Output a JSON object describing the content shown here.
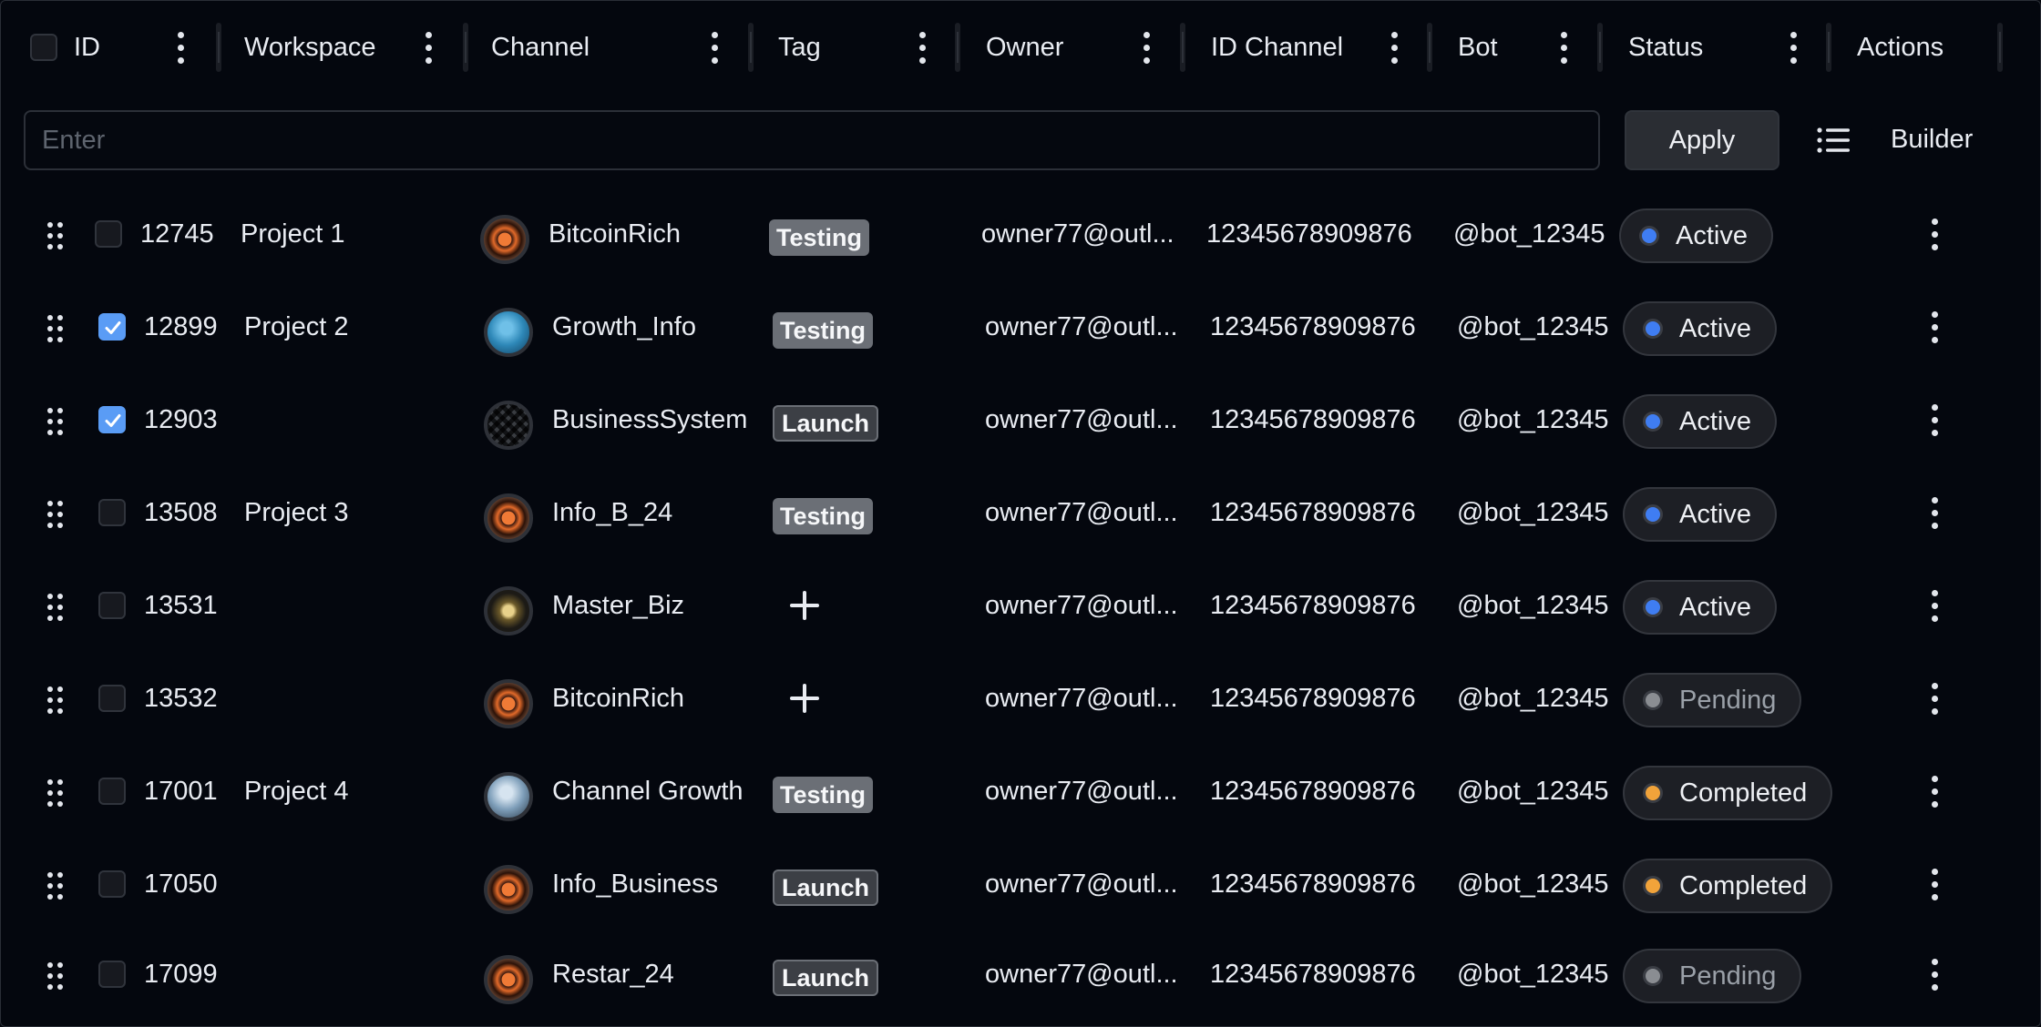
{
  "columns": {
    "id": "ID",
    "workspace": "Workspace",
    "channel": "Channel",
    "tag": "Tag",
    "owner": "Owner",
    "id_channel": "ID Channel",
    "bot": "Bot",
    "status": "Status",
    "actions": "Actions"
  },
  "filter": {
    "placeholder": "Enter",
    "value": ""
  },
  "toolbar": {
    "apply_label": "Apply",
    "builder_label": "Builder",
    "list_icon": "list-icon"
  },
  "colors": {
    "checked": "#5a9cf5",
    "active_dot": "#3f7df2",
    "completed_dot": "#f1a33a",
    "pending_dot": "#8a8d92"
  },
  "rows": [
    {
      "checked": false,
      "id": "12745",
      "workspace": "Project 1",
      "channel": "BitcoinRich",
      "avatar": "fire",
      "tag": "Testing",
      "owner": "owner77@outl...",
      "id_channel": "12345678909876",
      "bot": "@bot_12345",
      "status": "Active"
    },
    {
      "checked": true,
      "id": "12899",
      "workspace": "Project 2",
      "channel": "Growth_Info",
      "avatar": "blue",
      "tag": "Testing",
      "owner": "owner77@outl...",
      "id_channel": "12345678909876",
      "bot": "@bot_12345",
      "status": "Active"
    },
    {
      "checked": true,
      "id": "12903",
      "workspace": "",
      "channel": "BusinessSystem",
      "avatar": "grid",
      "tag": "Launch",
      "owner": "owner77@outl...",
      "id_channel": "12345678909876",
      "bot": "@bot_12345",
      "status": "Active"
    },
    {
      "checked": false,
      "id": "13508",
      "workspace": "Project 3",
      "channel": "Info_B_24",
      "avatar": "fire",
      "tag": "Testing",
      "owner": "owner77@outl...",
      "id_channel": "12345678909876",
      "bot": "@bot_12345",
      "status": "Active"
    },
    {
      "checked": false,
      "id": "13531",
      "workspace": "",
      "channel": "Master_Biz",
      "avatar": "gold",
      "tag": "",
      "owner": "owner77@outl...",
      "id_channel": "12345678909876",
      "bot": "@bot_12345",
      "status": "Active"
    },
    {
      "checked": false,
      "id": "13532",
      "workspace": "",
      "channel": "BitcoinRich",
      "avatar": "fire",
      "tag": "",
      "owner": "owner77@outl...",
      "id_channel": "12345678909876",
      "bot": "@bot_12345",
      "status": "Pending"
    },
    {
      "checked": false,
      "id": "17001",
      "workspace": "Project 4",
      "channel": "Channel Growth",
      "avatar": "ice",
      "tag": "Testing",
      "owner": "owner77@outl...",
      "id_channel": "12345678909876",
      "bot": "@bot_12345",
      "status": "Completed"
    },
    {
      "checked": false,
      "id": "17050",
      "workspace": "",
      "channel": "Info_Business",
      "avatar": "fire",
      "tag": "Launch",
      "owner": "owner77@outl...",
      "id_channel": "12345678909876",
      "bot": "@bot_12345",
      "status": "Completed"
    },
    {
      "checked": false,
      "id": "17099",
      "workspace": "",
      "channel": "Restar_24",
      "avatar": "fire",
      "tag": "Launch",
      "owner": "owner77@outl...",
      "id_channel": "12345678909876",
      "bot": "@bot_12345",
      "status": "Pending"
    }
  ]
}
